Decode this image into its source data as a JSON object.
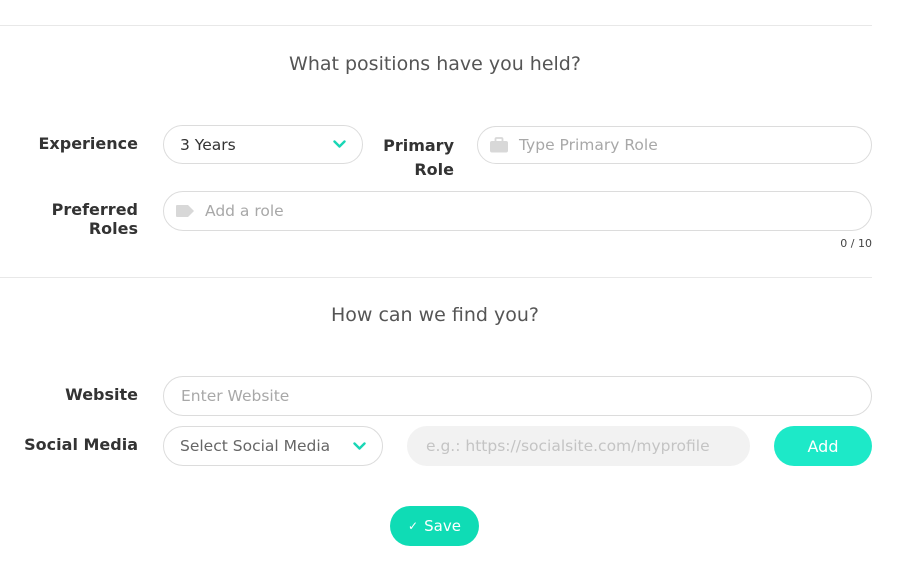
{
  "sections": {
    "positions_title": "What positions have you held?",
    "find_title": "How can we find you?"
  },
  "experience": {
    "label": "Experience",
    "selected": "3 Years"
  },
  "primary_role": {
    "label_line1": "Primary",
    "label_line2": "Role",
    "placeholder": "Type Primary Role"
  },
  "preferred_roles": {
    "label": "Preferred Roles",
    "placeholder": "Add a role",
    "counter": "0 / 10"
  },
  "website": {
    "label": "Website",
    "placeholder": "Enter Website"
  },
  "social_media": {
    "label": "Social Media",
    "select_placeholder": "Select Social Media",
    "url_placeholder": "e.g.: https://socialsite.com/myprofile",
    "add_label": "Add"
  },
  "save": {
    "label": "Save",
    "check_glyph": "✓"
  },
  "colors": {
    "accent": "#1de9c8",
    "accent_strong": "#0fdcb5",
    "chevron": "#18d6b5",
    "placeholder": "#a8a8a8",
    "border": "#dcdcdc"
  },
  "icons": {
    "primary_role": "briefcase-icon",
    "preferred_roles": "tag-icon",
    "dropdown": "chevron-down-icon",
    "save": "check-icon"
  }
}
